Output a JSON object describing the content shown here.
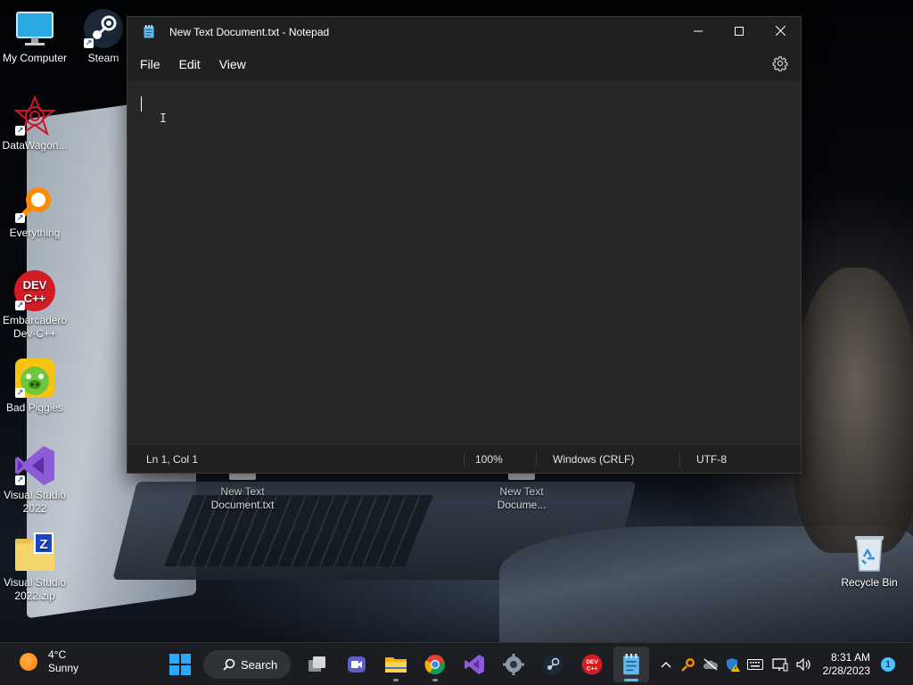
{
  "desktop": {
    "icons": [
      {
        "label": "My Computer",
        "icon": "monitor-icon",
        "shortcut": false
      },
      {
        "label": "Steam",
        "icon": "steam-icon",
        "shortcut": true
      },
      {
        "label": "DataWagon...",
        "icon": "datawagon-icon",
        "shortcut": true
      },
      {
        "label": "Everything",
        "icon": "everything-search-icon",
        "shortcut": true
      },
      {
        "label": "Embarcadero Dev-C++",
        "icon": "devcpp-icon",
        "shortcut": true
      },
      {
        "label": "Bad Piggies",
        "icon": "bad-piggies-icon",
        "shortcut": true
      },
      {
        "label": "Visual Studio 2022",
        "icon": "visual-studio-icon",
        "shortcut": true
      },
      {
        "label": "Visual Studio 2022.zip",
        "icon": "zip-archive-icon",
        "shortcut": false
      },
      {
        "label": "Recycle Bin",
        "icon": "recycle-bin-icon",
        "shortcut": false
      }
    ],
    "files": [
      {
        "label": "New Text Document.txt"
      },
      {
        "label": "New Text Docume..."
      }
    ]
  },
  "notepad": {
    "title": "New Text Document.txt - Notepad",
    "menu": [
      "File",
      "Edit",
      "View"
    ],
    "controls": {
      "minimize": "—",
      "maximize": "☐",
      "close": "✕"
    },
    "content": "",
    "status": {
      "position": "Ln 1, Col 1",
      "zoom": "100%",
      "line_ending": "Windows (CRLF)",
      "encoding": "UTF-8"
    }
  },
  "taskbar": {
    "weather": {
      "temp": "4°C",
      "condition": "Sunny"
    },
    "search_label": "Search",
    "apps": [
      {
        "name": "task-view",
        "icon": "task-view-icon"
      },
      {
        "name": "meet",
        "icon": "camera-icon"
      },
      {
        "name": "file-explorer",
        "icon": "folder-icon"
      },
      {
        "name": "chrome",
        "icon": "chrome-icon"
      },
      {
        "name": "visual-studio",
        "icon": "visual-studio-icon"
      },
      {
        "name": "settings",
        "icon": "gear-icon"
      },
      {
        "name": "steam",
        "icon": "steam-icon"
      },
      {
        "name": "devcpp",
        "icon": "devcpp-icon"
      },
      {
        "name": "notepad",
        "icon": "notepad-icon"
      }
    ],
    "tray": {
      "time": "8:31 AM",
      "date": "2/28/2023",
      "notification_count": "1"
    }
  },
  "colors": {
    "accent": "#4cc2ff",
    "window_bg": "#202020",
    "editor_bg": "#272727"
  }
}
